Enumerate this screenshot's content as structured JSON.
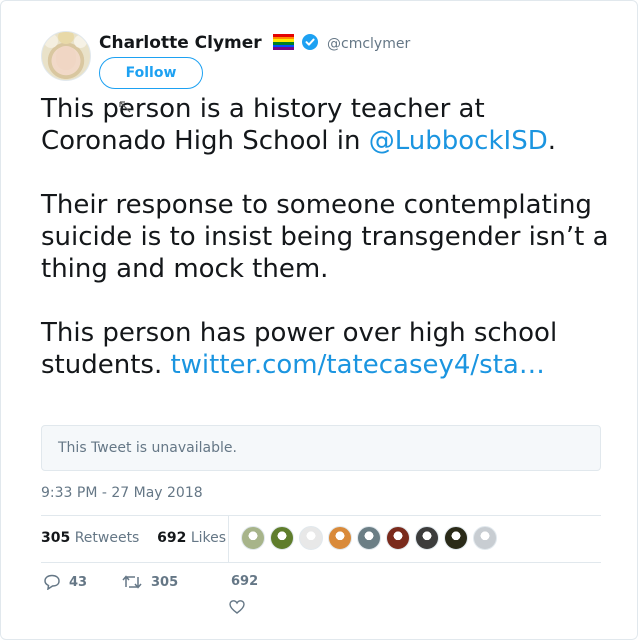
{
  "author": {
    "name": "Charlotte Clymer",
    "handle": "@cmclymer",
    "verified": true,
    "flag_colors": [
      "#e40303",
      "#ff8c00",
      "#ffed00",
      "#008026",
      "#004dff",
      "#750787"
    ]
  },
  "follow_label": "Follow",
  "tweet": {
    "p1_a": "This person is a history teacher at Coronado High School in ",
    "p1_mention": "@LubbockISD",
    "p1_b": ".",
    "p2": "Their response to someone contemplating suicide is to insist being transgender isn’t a thing and mock them.",
    "p3_a": "This person has power over high school students. ",
    "p3_link": "twitter.com/tatecasey4/sta…"
  },
  "quoted": {
    "text": "This Tweet is unavailable."
  },
  "timestamp": "9:33 PM - 27 May 2018",
  "stats": {
    "retweets_count": "305",
    "retweets_label": "Retweets",
    "likes_count": "692",
    "likes_label": "Likes"
  },
  "liker_avatars": [
    "#a7b48a",
    "#5f7d2c",
    "#e8e8e8",
    "#d98a3a",
    "#6b7e85",
    "#7a2a1c",
    "#3c3c3c",
    "#2a2a18",
    "#c8cdd2"
  ],
  "actions": {
    "reply_count": "43",
    "retweet_count": "305",
    "like_count": "692"
  },
  "colors": {
    "accent": "#1da1f2",
    "link": "#1b95e0",
    "muted": "#657786",
    "border": "#e1e8ed"
  }
}
